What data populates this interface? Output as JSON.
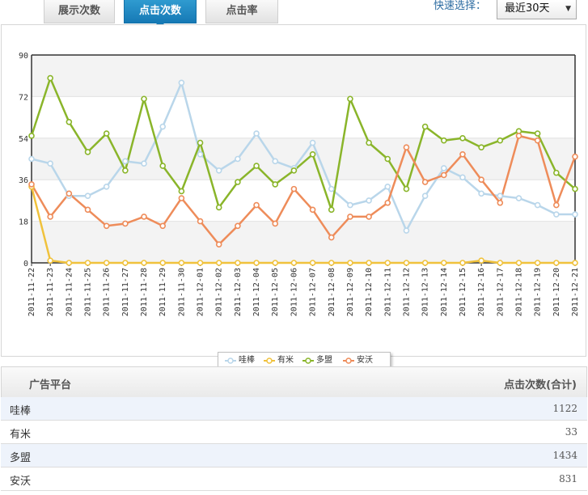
{
  "tabs": [
    {
      "label": "展示次数",
      "active": false
    },
    {
      "label": "点击次数",
      "active": true
    },
    {
      "label": "点击率",
      "active": false
    }
  ],
  "quick_select": {
    "label": "快速选择：",
    "value": "最近30天"
  },
  "chart_data": {
    "type": "line",
    "ylim": [
      0,
      90
    ],
    "yticks": [
      "0",
      "18",
      "36",
      "54",
      "72",
      "90"
    ],
    "x": [
      "2011-11-22",
      "2011-11-23",
      "2011-11-24",
      "2011-11-25",
      "2011-11-26",
      "2011-11-27",
      "2011-11-28",
      "2011-11-29",
      "2011-11-30",
      "2011-12-01",
      "2011-12-02",
      "2011-12-03",
      "2011-12-04",
      "2011-12-05",
      "2011-12-06",
      "2011-12-07",
      "2011-12-08",
      "2011-12-09",
      "2011-12-10",
      "2011-12-11",
      "2011-12-12",
      "2011-12-13",
      "2011-12-14",
      "2011-12-15",
      "2011-12-16",
      "2011-12-17",
      "2011-12-18",
      "2011-12-19",
      "2011-12-20",
      "2011-12-21"
    ],
    "series": [
      {
        "name": "哇棒",
        "color": "#b9d6ea",
        "values": [
          45,
          43,
          29,
          29,
          33,
          44,
          43,
          59,
          78,
          47,
          40,
          45,
          56,
          44,
          41,
          52,
          32,
          25,
          27,
          33,
          14,
          29,
          41,
          37,
          30,
          29,
          28,
          25,
          21,
          21
        ]
      },
      {
        "name": "有米",
        "color": "#f0c23c",
        "values": [
          33,
          1,
          0,
          0,
          0,
          0,
          0,
          0,
          0,
          0,
          0,
          0,
          0,
          0,
          0,
          0,
          0,
          0,
          0,
          0,
          0,
          0,
          0,
          0,
          1,
          0,
          0,
          0,
          0,
          0
        ]
      },
      {
        "name": "多盟",
        "color": "#8ab52a",
        "values": [
          55,
          80,
          61,
          48,
          56,
          40,
          71,
          42,
          31,
          52,
          24,
          35,
          42,
          34,
          40,
          47,
          23,
          71,
          52,
          45,
          32,
          59,
          53,
          54,
          50,
          53,
          57,
          56,
          39,
          32
        ]
      },
      {
        "name": "安沃",
        "color": "#ee8c5a",
        "values": [
          34,
          20,
          30,
          23,
          16,
          17,
          20,
          16,
          28,
          18,
          8,
          16,
          25,
          17,
          32,
          23,
          11,
          20,
          20,
          26,
          50,
          35,
          38,
          47,
          36,
          26,
          55,
          53,
          25,
          46
        ]
      }
    ],
    "legend_position": "bottom",
    "grid": true
  },
  "table": {
    "headers": {
      "platform": "广告平台",
      "clicks": "点击次数(合计)"
    },
    "rows": [
      {
        "platform": "哇棒",
        "clicks": "1122"
      },
      {
        "platform": "有米",
        "clicks": "33"
      },
      {
        "platform": "多盟",
        "clicks": "1434"
      },
      {
        "platform": "安沃",
        "clicks": "831"
      }
    ]
  }
}
